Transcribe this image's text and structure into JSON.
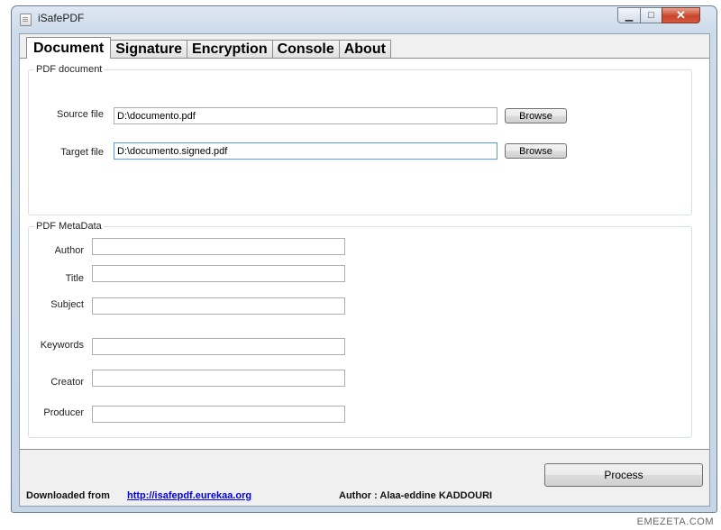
{
  "window": {
    "title": "iSafePDF",
    "controls": {
      "minimize": "▁",
      "maximize": "□",
      "close": "✕"
    }
  },
  "tabs": [
    {
      "label": "Document",
      "active": true
    },
    {
      "label": "Signature",
      "active": false
    },
    {
      "label": "Encryption",
      "active": false
    },
    {
      "label": "Console",
      "active": false
    },
    {
      "label": "About",
      "active": false
    }
  ],
  "pdf_document": {
    "legend": "PDF document",
    "source_label": "Source file",
    "source_value": "D:\\documento.pdf",
    "target_label": "Target file",
    "target_value": "D:\\documento.signed.pdf",
    "browse_label": "Browse"
  },
  "metadata": {
    "legend": "PDF MetaData",
    "fields": [
      {
        "label": "Author",
        "value": ""
      },
      {
        "label": "Title",
        "value": ""
      },
      {
        "label": "Subject",
        "value": ""
      },
      {
        "label": "Keywords",
        "value": ""
      },
      {
        "label": "Creator",
        "value": ""
      },
      {
        "label": "Producer",
        "value": ""
      }
    ]
  },
  "process_label": "Process",
  "footer": {
    "downloaded_label": "Downloaded from",
    "link": "http://isafepdf.eurekaa.org",
    "author": "Author : Alaa-eddine KADDOURI"
  },
  "watermark": "EMEZETA.COM",
  "colors": {
    "link": "#0000ee",
    "focus_border": "#569de5",
    "close_button": "#c9452c"
  }
}
